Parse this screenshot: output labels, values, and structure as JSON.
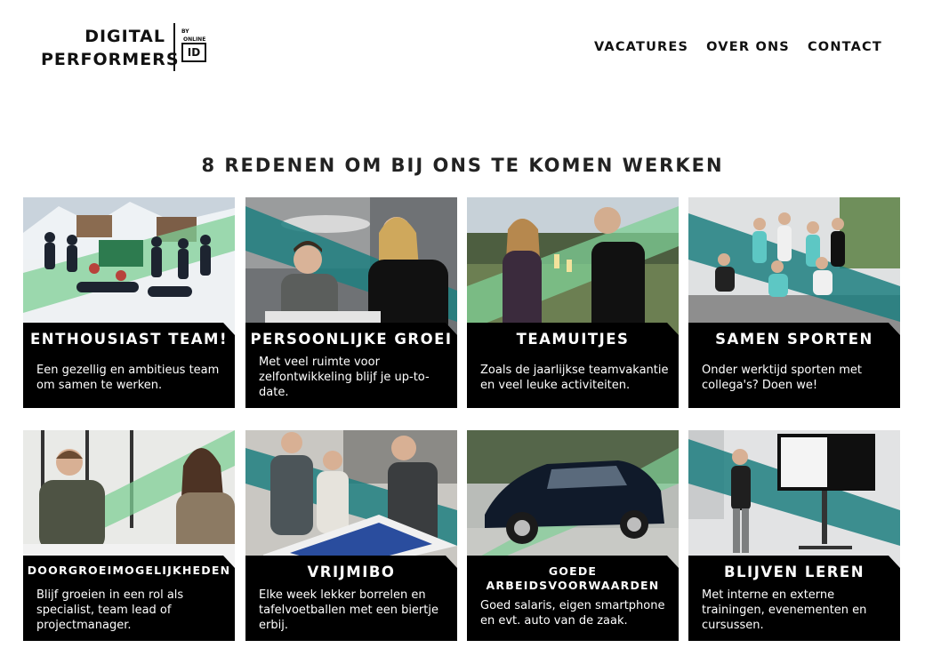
{
  "header": {
    "logo": {
      "line1": "DIGITAL",
      "line2": "PERFORMERS",
      "by": "BY",
      "online": "ONLINE",
      "id": "ID"
    },
    "nav": [
      "VACATURES",
      "OVER ONS",
      "CONTACT"
    ]
  },
  "title": "8 REDENEN OM BIJ ONS TE KOMEN WERKEN",
  "colors": {
    "accent_teal": "#1e7f80",
    "accent_green": "#7fcf96",
    "caption_bg": "#000000"
  },
  "cards": [
    {
      "title": "ENTHOUSIAST TEAM!",
      "desc": "Een gezellig en ambitieus team om samen te werken.",
      "photo": "team-mountain-photo"
    },
    {
      "title": "PERSOONLIJKE GROEI",
      "desc": "Met veel ruimte voor zelfontwikkeling blijf je up-to-date.",
      "photo": "office-colleagues-photo"
    },
    {
      "title": "TEAMUITJES",
      "desc": "Zoals de jaarlijkse teamvakantie en veel leuke activiteiten.",
      "photo": "toast-photo"
    },
    {
      "title": "SAMEN SPORTEN",
      "desc": "Onder werktijd sporten met collega's? Doen we!",
      "photo": "sport-group-photo"
    },
    {
      "title": "DOORGROEIMOGELIJKHEDEN",
      "desc": "Blijf groeien in een rol als specialist, team lead of projectmanager.",
      "photo": "meeting-photo"
    },
    {
      "title": "VRIJMIBO",
      "desc": "Elke week lekker borrelen en tafelvoetballen met een biertje erbij.",
      "photo": "foosball-photo"
    },
    {
      "title": "GOEDE ARBEIDSVOORWAARDEN",
      "desc": "Goed salaris, eigen smartphone en evt. auto van de zaak.",
      "photo": "company-car-photo"
    },
    {
      "title": "BLIJVEN LEREN",
      "desc": "Met interne en externe trainingen, evenementen en cursussen.",
      "photo": "presentation-photo"
    }
  ]
}
